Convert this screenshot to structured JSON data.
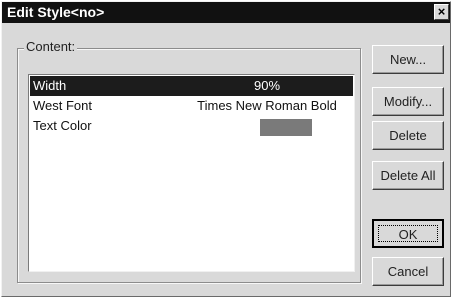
{
  "window": {
    "title": "Edit Style<no>",
    "close_glyph": "×"
  },
  "group": {
    "label": "Content:"
  },
  "rows": [
    {
      "name": "Width",
      "value": "90%",
      "selected": true
    },
    {
      "name": "West Font",
      "value": "Times New Roman Bold",
      "selected": false
    },
    {
      "name": "Text Color",
      "value": "",
      "swatch_color": "#7a7a7a",
      "selected": false
    }
  ],
  "buttons": {
    "new": "New...",
    "modify": "Modify...",
    "delete": "Delete",
    "delete_all": "Delete All",
    "ok": "OK",
    "cancel": "Cancel"
  },
  "colors": {
    "titlebar": "#111111",
    "selection": "#1c1c1c",
    "face": "#d9d9d9"
  }
}
